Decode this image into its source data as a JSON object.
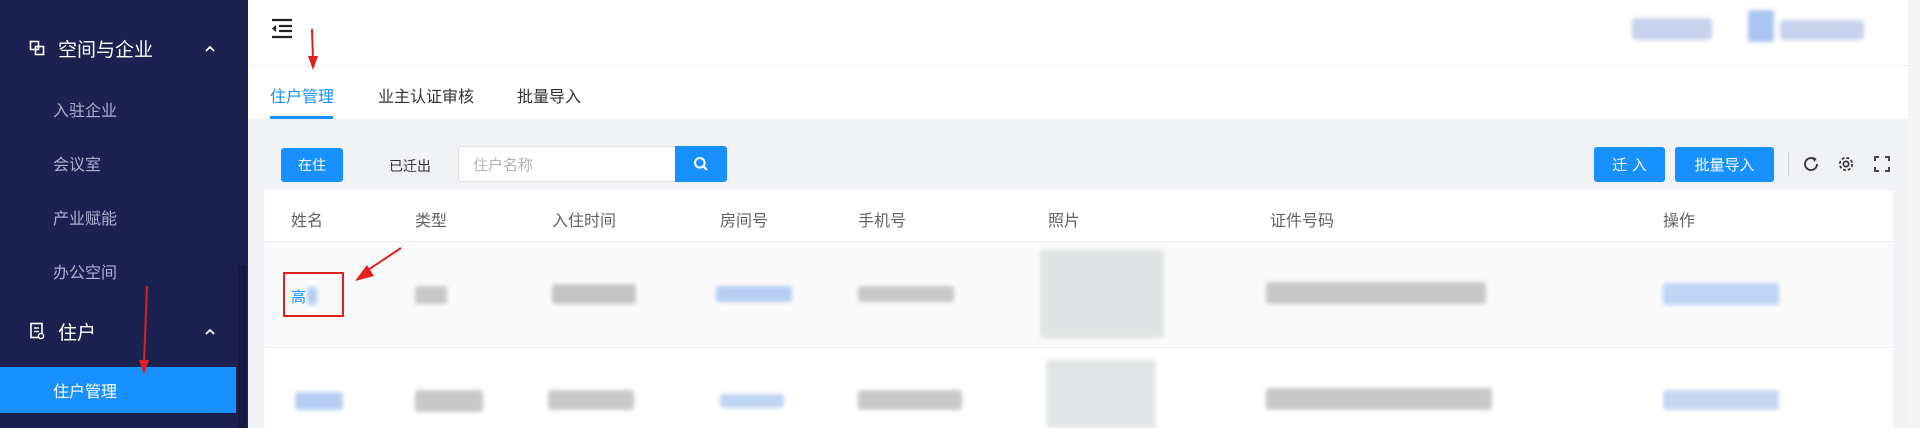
{
  "sidebar": {
    "groups": [
      {
        "label": "空间与企业",
        "icon": "building-icon"
      },
      {
        "label": "住户",
        "icon": "resident-icon"
      }
    ],
    "items": [
      {
        "label": "入驻企业"
      },
      {
        "label": "会议室"
      },
      {
        "label": "产业赋能"
      },
      {
        "label": "办公空间"
      },
      {
        "label": "住户管理"
      }
    ]
  },
  "tabs": [
    "住户管理",
    "业主认证审核",
    "批量导入"
  ],
  "toolbar": {
    "status_active": "在住",
    "status_moved_out": "已迁出",
    "search_placeholder": "住户名称",
    "move_in_label": "迁 入",
    "bulk_import_label": "批量导入"
  },
  "table": {
    "columns": [
      "姓名",
      "类型",
      "入住时间",
      "房间号",
      "手机号",
      "照片",
      "证件号码",
      "操作"
    ],
    "rows": [
      {
        "name": "高"
      }
    ]
  },
  "colors": {
    "sidebar_bg": "#1b2250",
    "accent": "#1890ff",
    "annotation": "#e02020"
  }
}
